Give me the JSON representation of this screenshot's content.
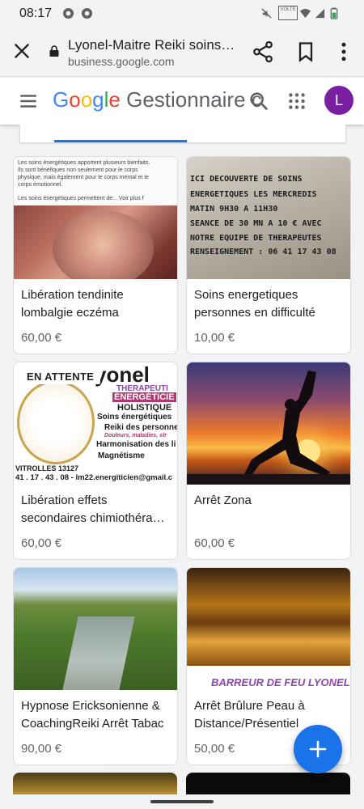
{
  "status_bar": {
    "time": "08:17",
    "volte_label": "VOLTE"
  },
  "browser": {
    "page_title": "Lyonel-Maitre Reiki soins…",
    "url": "business.google.com",
    "close_icon": "close-icon",
    "lock_icon": "lock-icon"
  },
  "app_header": {
    "logo_google": "Google",
    "logo_rest": "Gestionnaire c",
    "avatar_letter": "L",
    "avatar_color": "#7b1fa2"
  },
  "colors": {
    "accent": "#1a73e8",
    "badge_text": "#202124",
    "price_text": "#5f6368"
  },
  "products": [
    {
      "title": "Libération tendinite lombalgie eczéma",
      "price": "60,00 €",
      "image_text": [
        "Les soins énergétiques apportent plusieurs bienfaits.",
        "Ils sont bénéfiques non seulement pour le corps",
        "physique, mais également pour le corps mental et le",
        "corps émotionnel.",
        "Les soins énergétiques permettent de:.. Voir plus f"
      ]
    },
    {
      "title": "Soins energetiques personnes en difficulté",
      "price": "10,00 €",
      "image_text": [
        "ICI DECOUVERTE DE SOINS",
        "ENERGETIQUES LES MERCREDIS",
        "MATIN 9H30 A 11H30",
        "SEANCE DE 30 MN A 10 € AVEC",
        "NOTRE EQUIPE DE THERAPEUTES",
        "RENSEIGNEMENT : 06 41 17 43 08"
      ]
    },
    {
      "title": "Libération effets secondaires chimiothéra…",
      "price": "60,00 €",
      "badge": "EN ATTENTE",
      "image_text": {
        "name": "yonel",
        "l1": "THERAPEUTI",
        "l2": "ÉNERGÉTICIE",
        "l3": "HOLISTIQUE",
        "l4": "Soins énergétiques",
        "l5": "Reiki des personne",
        "l6": "Douleurs, maladies, str",
        "l7": "Harmonisation des li",
        "l8": "Magnétisme",
        "l9": "VITROLLES 13127",
        "l10": "41 . 17 . 43 . 08 - lm22.energiticien@gmail.c"
      }
    },
    {
      "title": "Arrêt Zona",
      "price": "60,00 €"
    },
    {
      "title": "Hypnose Ericksonienne & CoachingReiki Arrêt Tabac",
      "price": "90,00 €"
    },
    {
      "title": "Arrêt Brûlure Peau à Distance/Présentiel",
      "price": "50,00 €",
      "image_text": "BARREUR DE FEU LYONEL"
    }
  ],
  "fab": {
    "icon": "plus-icon"
  }
}
